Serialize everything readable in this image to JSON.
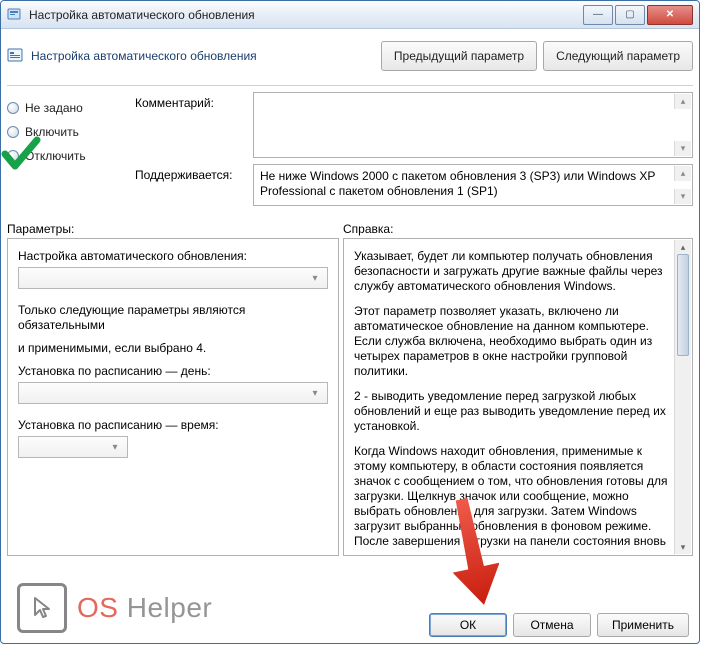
{
  "window": {
    "title": "Настройка автоматического обновления"
  },
  "header": {
    "title": "Настройка автоматического обновления",
    "prev_btn": "Предыдущий параметр",
    "next_btn": "Следующий параметр"
  },
  "radio": {
    "not_configured": "Не задано",
    "enabled": "Включить",
    "disabled": "Отключить"
  },
  "fields": {
    "comment_label": "Комментарий:",
    "supported_label": "Поддерживается:",
    "supported_text": "Не ниже Windows 2000 с пакетом обновления 3 (SP3) или Windows XP Professional с пакетом обновления 1 (SP1)"
  },
  "sections": {
    "parameters_label": "Параметры:",
    "help_label": "Справка:"
  },
  "parameters": {
    "config_label": "Настройка автоматического обновления:",
    "required_note_1": "Только следующие параметры являются обязательными",
    "required_note_2": "и применимыми, если выбрано 4.",
    "schedule_day_label": "Установка по расписанию — день:",
    "schedule_time_label": "Установка по расписанию — время:"
  },
  "help": {
    "p1": "Указывает, будет ли компьютер получать обновления безопасности и загружать другие важные файлы через службу автоматического обновления Windows.",
    "p2": "Этот параметр позволяет указать, включено ли автоматическое обновление на данном компьютере. Если служба включена, необходимо выбрать один из четырех параметров в окне настройки групповой политики.",
    "p3": "2 - выводить уведомление перед загрузкой любых обновлений и еще раз выводить уведомление перед их установкой.",
    "p4": "Когда Windows находит обновления, применимые к этому компьютеру, в области состояния появляется значок с сообщением о том, что обновления готовы для загрузки. Щелкнув значок или сообщение, можно выбрать обновления для загрузки. Затем Windows загрузит выбранные обновления в фоновом режиме. После завершения загрузки на панели состояния вновь"
  },
  "buttons": {
    "ok": "ОК",
    "cancel": "Отмена",
    "apply": "Применить"
  },
  "watermark": {
    "os": "OS",
    "helper": " Helper"
  }
}
